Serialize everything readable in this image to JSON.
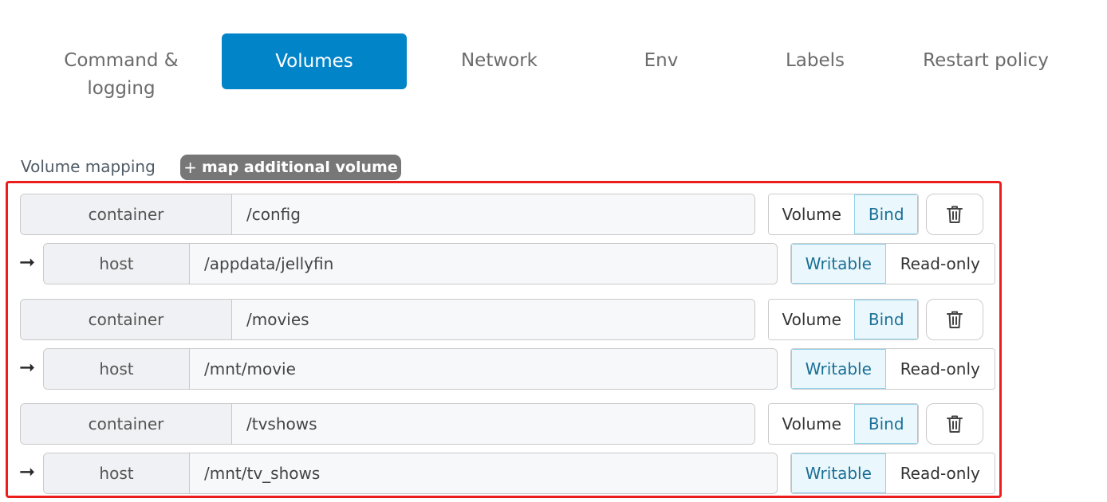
{
  "tabs": [
    {
      "label_line1": "Command &",
      "label_line2": "logging",
      "active": false
    },
    {
      "label": "Volumes",
      "active": true
    },
    {
      "label": "Network",
      "active": false
    },
    {
      "label": "Env",
      "active": false
    },
    {
      "label": "Labels",
      "active": false
    },
    {
      "label": "Restart policy",
      "active": false
    }
  ],
  "volume_mapping": {
    "label": "Volume mapping",
    "add_button": {
      "icon": "plus-icon",
      "label": "map additional volume"
    },
    "mappings": [
      {
        "container_label": "container",
        "container_value": "/config",
        "type_options": [
          "Volume",
          "Bind"
        ],
        "type_selected": "Bind",
        "host_label": "host",
        "host_value": "/appdata/jellyfin",
        "mode_options": [
          "Writable",
          "Read-only"
        ],
        "mode_selected": "Writable"
      },
      {
        "container_label": "container",
        "container_value": "/movies",
        "type_options": [
          "Volume",
          "Bind"
        ],
        "type_selected": "Bind",
        "host_label": "host",
        "host_value": "/mnt/movie",
        "mode_options": [
          "Writable",
          "Read-only"
        ],
        "mode_selected": "Writable"
      },
      {
        "container_label": "container",
        "container_value": "/tvshows",
        "type_options": [
          "Volume",
          "Bind"
        ],
        "type_selected": "Bind",
        "host_label": "host",
        "host_value": "/mnt/tv_shows",
        "mode_options": [
          "Writable",
          "Read-only"
        ],
        "mode_selected": "Writable"
      }
    ]
  },
  "icons": {
    "arrow": "arrow-right-icon",
    "delete": "trash-icon"
  },
  "colors": {
    "accent": "#0284c8",
    "highlight_frame": "#ee1d1d",
    "add_button_bg": "#777777",
    "selected_option_bg": "#eaf7fc"
  }
}
